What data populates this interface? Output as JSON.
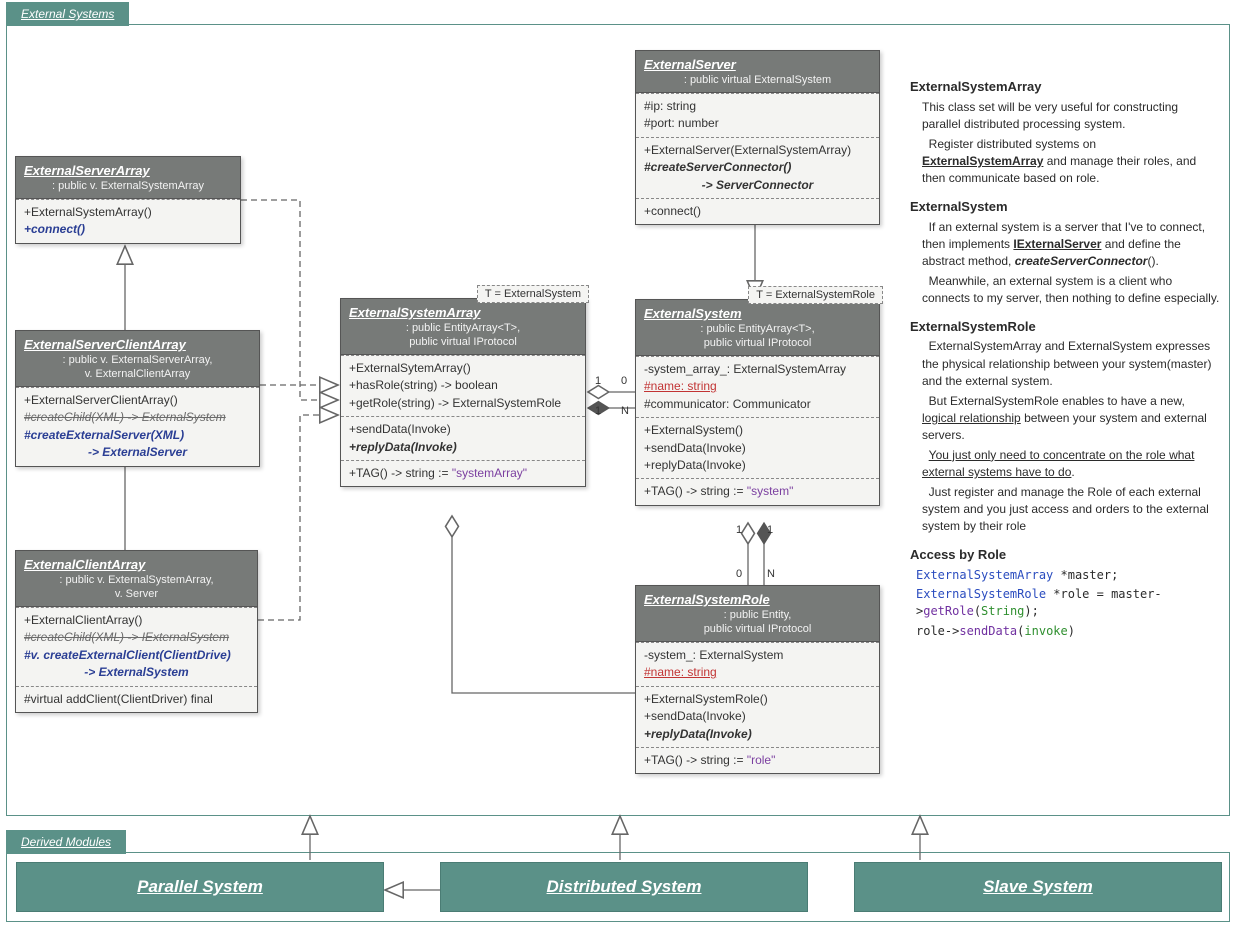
{
  "packages": {
    "external": {
      "label": "External Systems"
    },
    "derived": {
      "label": "Derived Modules"
    }
  },
  "classes": {
    "esa_left": {
      "title": "ExternalServerArray",
      "sub": ": public v. ExternalSystemArray",
      "section1": [
        "+ExternalSystemArray()",
        "+connect()"
      ],
      "connect_label": "+connect()"
    },
    "esca": {
      "title": "ExternalServerClientArray",
      "sub1": ": public v. ExternalServerArray,",
      "sub2": "v. ExternalClientArray",
      "m1": "+ExternalServerClientArray()",
      "m2": "#createChild(XML) -> ExternalSystem",
      "m3": "#createExternalServer(XML)",
      "m3r": "-> ExternalServer"
    },
    "eca": {
      "title": "ExternalClientArray",
      "sub1": ": public v. ExternalSystemArray,",
      "sub2": "v. Server",
      "m1": "+ExternalClientArray()",
      "m2": "#createChild(XML) -> IExternalSystem",
      "m3": "#v. createExternalClient(ClientDrive)",
      "m3r": "-> ExternalSystem",
      "m4": "#virtual addClient(ClientDriver) final"
    },
    "esarray": {
      "tparam": "T = ExternalSystem",
      "title": "ExternalSystemArray",
      "sub1": ": public EntityArray<T>,",
      "sub2": "public virtual IProtocol",
      "m1": "+ExternalSytemArray()",
      "m2": "+hasRole(string) -> boolean",
      "m3": "+getRole(string) -> ExternalSystemRole",
      "m4": "+sendData(Invoke)",
      "m5": "+replyData(Invoke)",
      "tag": "+TAG() -> string := ",
      "tagval": "\"systemArray\""
    },
    "eserver": {
      "title": "ExternalServer",
      "sub": ": public virtual ExternalSystem",
      "a1": "#ip: string",
      "a2": "#port: number",
      "m1": "+ExternalServer(ExternalSystemArray)",
      "m2": "#createServerConnector()",
      "m2r": "-> ServerConnector",
      "m3": "+connect()"
    },
    "esystem": {
      "tparam": "T = ExternalSystemRole",
      "title": "ExternalSystem",
      "sub1": ": public EntityArray<T>,",
      "sub2": "public virtual IProtocol",
      "a1": "-system_array_: ExternalSystemArray",
      "a2": "#name: string",
      "a3": "#communicator: Communicator",
      "m1": "+ExternalSystem()",
      "m2": "+sendData(Invoke)",
      "m3": "+replyData(Invoke)",
      "tag": "+TAG() -> string := ",
      "tagval": "\"system\""
    },
    "esrole": {
      "title": "ExternalSystemRole",
      "sub1": ": public Entity,",
      "sub2": "public virtual IProtocol",
      "a1": "-system_: ExternalSystem",
      "a2": "#name: string",
      "m1": "+ExternalSystemRole()",
      "m2": "+sendData(Invoke)",
      "m3": "+replyData(Invoke)",
      "tag": "+TAG() -> string := ",
      "tagval": "\"role\""
    }
  },
  "multiplicities": {
    "one": "1",
    "zero": "0",
    "n": "N"
  },
  "doc": {
    "h1": "ExternalSystemArray",
    "p1": "This class set will be very useful for constructing parallel distributed processing system.",
    "p2a": "Register distributed systems on ",
    "p2b": "ExternalSystemArray",
    "p2c": " and manage their roles, and then communicate based on role.",
    "h2": "ExternalSystem",
    "p3a": "If an external system is a server that I've to connect, then implements ",
    "p3b": "IExternalServer",
    "p3c": " and define the abstract method, ",
    "p3d": "createServerConnector",
    "p3e": "().",
    "p4": "Meanwhile, an external system is a client who connects to my server, then nothing to define especially.",
    "h3": "ExternalSystemRole",
    "p5": "ExternalSystemArray and ExternalSystem expresses the physical relationship between your system(master) and the external system.",
    "p6a": "But ExternalSystemRole enables to have a new, ",
    "p6b": "logical relationship",
    "p6c": " between your system and external servers.",
    "p7": "You just only need to concentrate on the role what external systems have to do",
    "p8": "Just register and manage the Role of each external system and you just access and orders to the external system by their role",
    "h4": "Access by Role",
    "code1a": "ExternalSystemArray",
    "code1b": " *master;",
    "code2a": "ExternalSystemRole",
    "code2b": " *role = master->",
    "code2c": "getRole",
    "code2d": "(",
    "code2e": "String",
    "code2f": ");",
    "code3a": "role->",
    "code3b": "sendData",
    "code3c": "(",
    "code3d": "invoke",
    "code3e": ")"
  },
  "modules": {
    "parallel": "Parallel System",
    "distributed": "Distributed System",
    "slave": "Slave System"
  }
}
